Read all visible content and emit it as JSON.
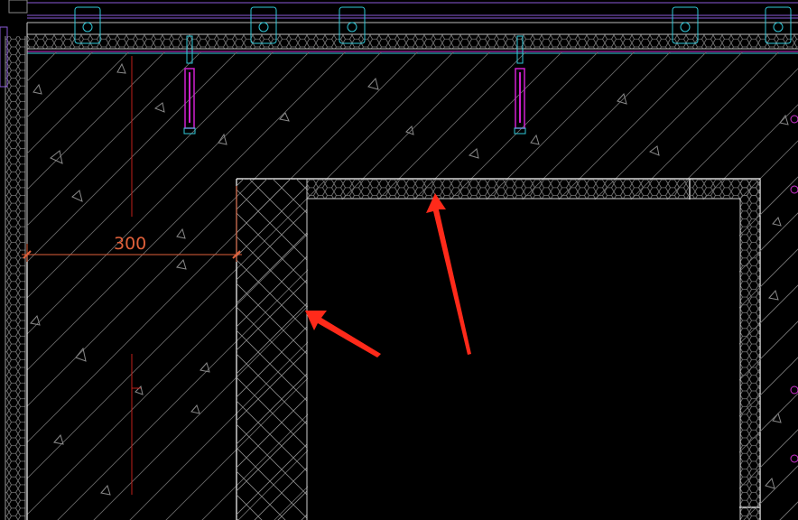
{
  "drawing": {
    "dimension_label": "300",
    "colors": {
      "background": "#000000",
      "concrete_hatch": "#8a8a8a",
      "insulation_hatch": "#7a7a7a",
      "outline": "#ffffff",
      "dimension": "#e0603a",
      "centerline": "#c0201a",
      "anchor_body": "#d020d0",
      "anchor_cyan": "#30c8d8",
      "rail_purple": "#8a5ad8",
      "annotation_arrow": "#ff2a1a"
    },
    "icons": [
      "annotation-arrow",
      "anchor-bolt",
      "bracket-clip"
    ]
  }
}
